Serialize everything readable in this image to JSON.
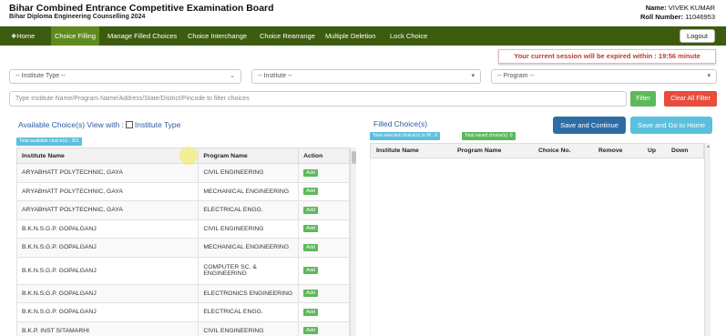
{
  "header": {
    "title": "Bihar Combined Entrance Competitive Examination Board",
    "subtitle": "Bihar Diploma Engineering Counselling 2024",
    "name_label": "Name:",
    "name_value": "VIVEK KUMAR",
    "roll_label": "Roll Number:",
    "roll_value": "11046953"
  },
  "nav": {
    "items": [
      "Home",
      "Choice Filling",
      "Manage Filled Choices",
      "Choice Interchange",
      "Choice Rearrange",
      "Multiple Deletion",
      "Lock Choice"
    ],
    "active": "Choice Filling",
    "home_icon": "home-icon",
    "logout": "Logout"
  },
  "session_alert": "Your current session will be expired within : 19:56 minute",
  "filters": {
    "institute_type": "-- Institute Type --",
    "institute": "-- Institute --",
    "program": "-- Program --",
    "search_placeholder": "Type Institute Name/Program Name/Address/State/District/Pincode to filter choices",
    "filter_button": "Filter",
    "clear_button": "Clear All Filter"
  },
  "available": {
    "heading": "Available Choice(s) View with :",
    "checkbox_label": "Institute Type",
    "total_badge": "Total available choice(s) : 261",
    "columns": [
      "Institute Name",
      "Program Name",
      "Action"
    ],
    "add_label": "Add",
    "rows": [
      {
        "institute": "ARYABHATT POLYTECHNIC, GAYA",
        "program": "CIVIL ENGINEERING"
      },
      {
        "institute": "ARYABHATT POLYTECHNIC, GAYA",
        "program": "MECHANICAL ENGINEERING"
      },
      {
        "institute": "ARYABHATT POLYTECHNIC, GAYA",
        "program": "ELECTRICAL ENGG."
      },
      {
        "institute": "B.K.N.S.G.P. GOPALGANJ",
        "program": "CIVIL ENGINEERING"
      },
      {
        "institute": "B.K.N.S.G.P. GOPALGANJ",
        "program": "MECHANICAL ENGINEERING"
      },
      {
        "institute": "B.K.N.S.G.P. GOPALGANJ",
        "program": "COMPUTER SC. & ENGINEERING"
      },
      {
        "institute": "B.K.N.S.G.P. GOPALGANJ",
        "program": "ELECTRONICS ENGINEERING"
      },
      {
        "institute": "B.K.N.S.G.P. GOPALGANJ",
        "program": "ELECTRICAL ENGG."
      },
      {
        "institute": "B.K.P. INST SITAMARHI",
        "program": "CIVIL ENGINEERING"
      }
    ]
  },
  "filled": {
    "heading": "Filled Choice(s)",
    "selected_badge": "Total selected choice(s) to fill : 0",
    "saved_badge": "Total saved choice(s): 0",
    "save_continue": "Save and Continue",
    "save_home": "Save and Go to Home",
    "columns": [
      "Institute Name",
      "Program Name",
      "Choice No.",
      "Remove",
      "Up",
      "Down"
    ]
  },
  "colors": {
    "nav_bg": "#3d5b0f",
    "nav_active": "#5f8a1d",
    "add_green": "#5cb85c",
    "primary_blue": "#2e6da4",
    "info_blue": "#5bc0de",
    "danger_red": "#e74c3c"
  }
}
